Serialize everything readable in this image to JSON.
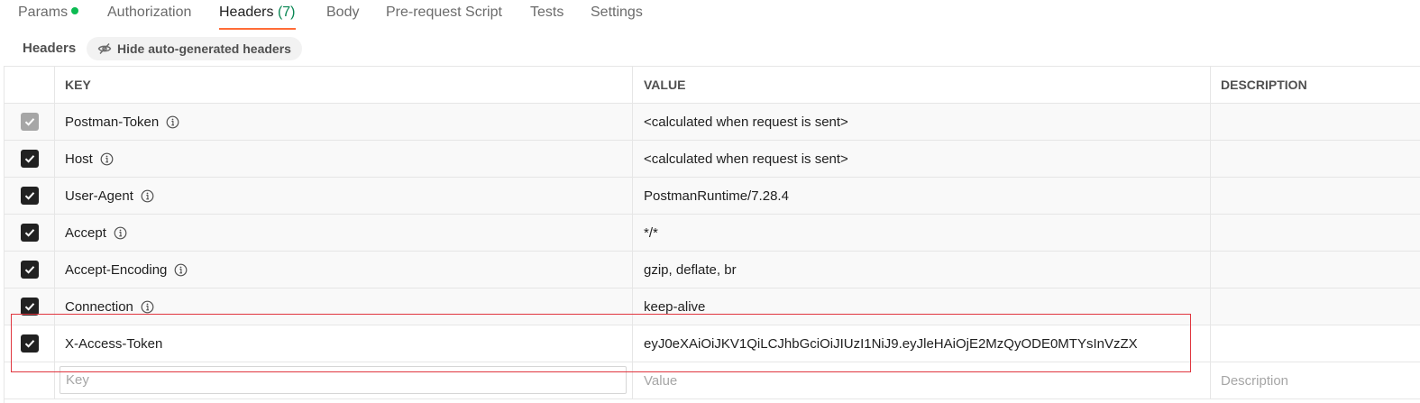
{
  "tabs": [
    {
      "label": "Params",
      "has_dot": true
    },
    {
      "label": "Authorization"
    },
    {
      "label": "Headers",
      "count": "(7)",
      "active": true
    },
    {
      "label": "Body"
    },
    {
      "label": "Pre-request Script"
    },
    {
      "label": "Tests"
    },
    {
      "label": "Settings"
    }
  ],
  "subbar": {
    "title": "Headers",
    "hide_button": "Hide auto-generated headers"
  },
  "table": {
    "columns": {
      "key": "KEY",
      "value": "VALUE",
      "description": "DESCRIPTION"
    },
    "rows": [
      {
        "key": "Postman-Token",
        "value": "<calculated when request is sent>",
        "checked": true,
        "disabled": true,
        "info": true
      },
      {
        "key": "Host",
        "value": "<calculated when request is sent>",
        "checked": true,
        "info": true
      },
      {
        "key": "User-Agent",
        "value": "PostmanRuntime/7.28.4",
        "checked": true,
        "info": true
      },
      {
        "key": "Accept",
        "value": "*/*",
        "checked": true,
        "info": true
      },
      {
        "key": "Accept-Encoding",
        "value": "gzip, deflate, br",
        "checked": true,
        "info": true
      },
      {
        "key": "Connection",
        "value": "keep-alive",
        "checked": true,
        "info": true
      },
      {
        "key": "X-Access-Token",
        "value": "eyJ0eXAiOiJKV1QiLCJhbGciOiJIUzI1NiJ9.eyJleHAiOjE2MzQyODE0MTYsInVzZX",
        "checked": true,
        "info": false
      }
    ],
    "new_row": {
      "key_placeholder": "Key",
      "value_placeholder": "Value",
      "description_placeholder": "Description"
    }
  },
  "colors": {
    "accent": "#ff6c37",
    "highlight": "#e0363f",
    "dot": "#0cbb52"
  }
}
